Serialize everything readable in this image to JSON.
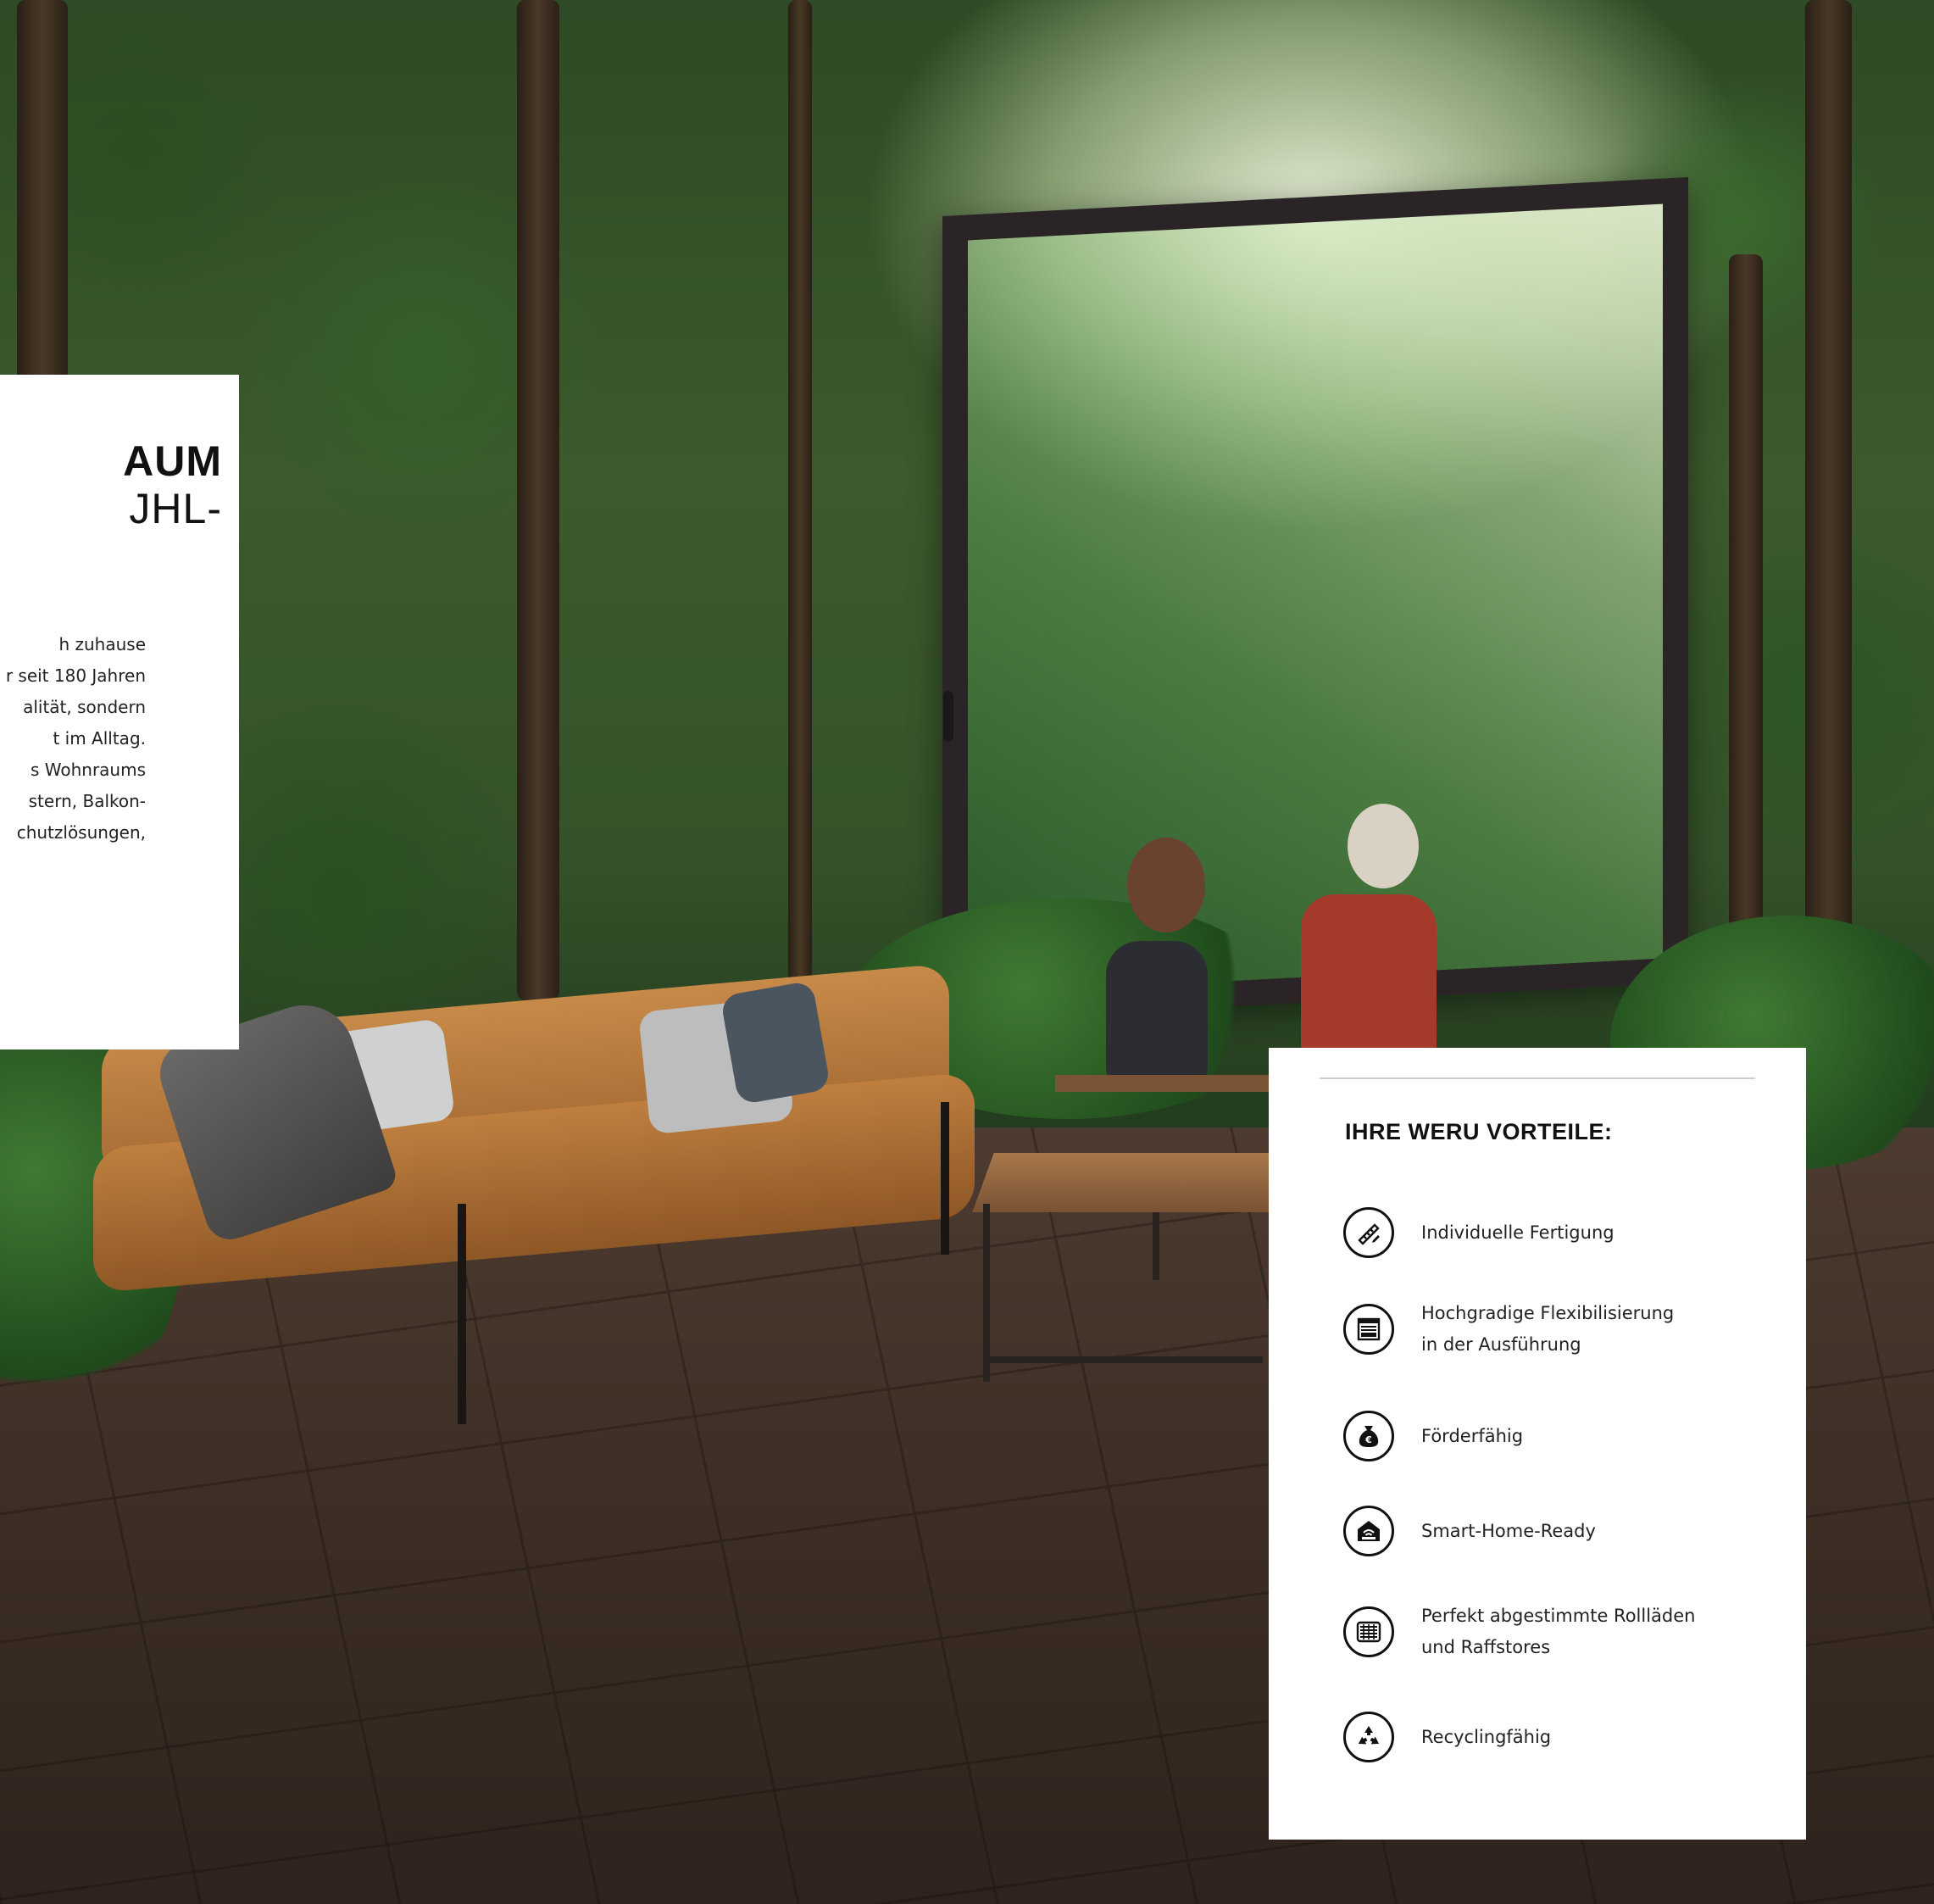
{
  "intro": {
    "headline_bold": "AUM",
    "headline_light": "JHL-",
    "body_lines": [
      "h zuhause",
      "r seit 180 Jahren",
      "alität, sondern",
      "t im Alltag.",
      "s Wohnraums",
      "stern, Balkon-",
      "chutzlösungen,"
    ]
  },
  "benefits": {
    "title": "IHRE WERU VORTEILE:",
    "items": [
      {
        "icon": "ruler-pencil-icon",
        "lines": [
          "Individuelle Fertigung"
        ]
      },
      {
        "icon": "window-blind-icon",
        "lines": [
          "Hochgradige Flexibilisierung",
          "in der Ausführung"
        ]
      },
      {
        "icon": "money-bag-euro-icon",
        "lines": [
          "Förderfähig"
        ]
      },
      {
        "icon": "smart-home-icon",
        "lines": [
          "Smart-Home-Ready"
        ]
      },
      {
        "icon": "roller-shutter-icon",
        "lines": [
          "Perfekt abgestimmte Rollläden",
          "und Raffstores"
        ]
      },
      {
        "icon": "recycling-icon",
        "lines": [
          "Recyclingfähig"
        ]
      }
    ]
  },
  "colors": {
    "panel_background": "#ffffff",
    "text": "#111111",
    "window_frame": "#2a2426"
  }
}
